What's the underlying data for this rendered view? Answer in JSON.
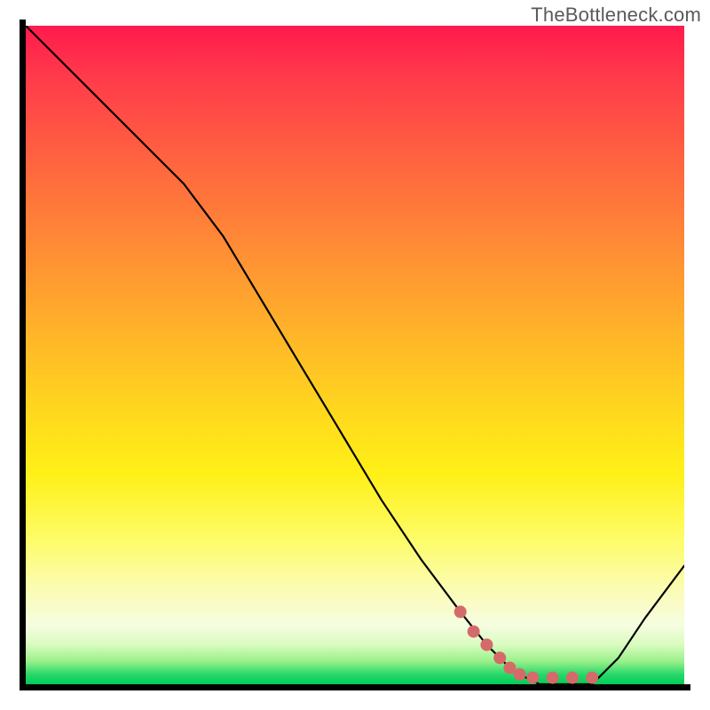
{
  "watermark": "TheBottleneck.com",
  "colors": {
    "curve_stroke": "#000000",
    "marker_fill": "#d56a6a",
    "axis": "#000000"
  },
  "chart_data": {
    "type": "line",
    "title": "",
    "xlabel": "",
    "ylabel": "",
    "xlim": [
      0,
      100
    ],
    "ylim": [
      0,
      100
    ],
    "grid": false,
    "legend": false,
    "series": [
      {
        "name": "bottleneck-curve",
        "x": [
          0,
          6,
          12,
          18,
          24,
          30,
          36,
          42,
          48,
          54,
          60,
          66,
          70,
          74,
          78,
          82,
          86,
          90,
          94,
          100
        ],
        "values": [
          100,
          94,
          88,
          82,
          76,
          68,
          58,
          48,
          38,
          28,
          19,
          11,
          6,
          2,
          0,
          0,
          0,
          4,
          10,
          18
        ]
      }
    ],
    "markers": [
      {
        "name": "highlight-dot",
        "x": 66,
        "y": 11
      },
      {
        "name": "highlight-dot",
        "x": 68,
        "y": 8
      },
      {
        "name": "highlight-dot",
        "x": 70,
        "y": 6
      },
      {
        "name": "highlight-dot",
        "x": 72,
        "y": 4
      },
      {
        "name": "highlight-dot",
        "x": 73.5,
        "y": 2.5
      },
      {
        "name": "highlight-dot",
        "x": 75,
        "y": 1.5
      },
      {
        "name": "highlight-dot",
        "x": 77,
        "y": 1
      },
      {
        "name": "highlight-dot",
        "x": 80,
        "y": 1
      },
      {
        "name": "highlight-dot",
        "x": 83,
        "y": 1
      },
      {
        "name": "highlight-dot",
        "x": 86,
        "y": 1
      }
    ],
    "marker_radius": 7
  }
}
